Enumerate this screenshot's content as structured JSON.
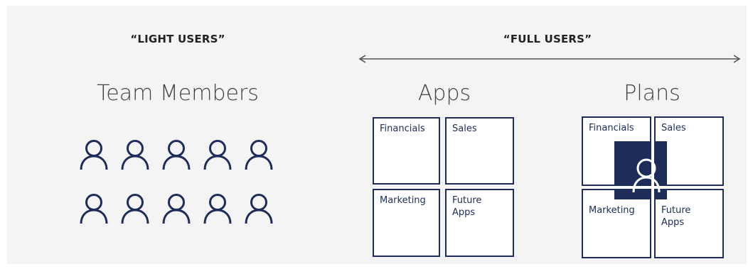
{
  "headings": {
    "light_users": "“LIGHT USERS”",
    "full_users": "“FULL USERS”"
  },
  "titles": {
    "team_members": "Team Members",
    "apps": "Apps",
    "plans": "Plans"
  },
  "apps_tiles": [
    {
      "label": "Financials",
      "highlighted": true
    },
    {
      "label": "Sales",
      "highlighted": false
    },
    {
      "label": "Marketing",
      "highlighted": false
    },
    {
      "label": "Future\nApps",
      "highlighted": false
    }
  ],
  "plans_tiles": [
    {
      "label": "Financials"
    },
    {
      "label": "Sales"
    },
    {
      "label": "Marketing"
    },
    {
      "label": "Future\nApps"
    }
  ],
  "icons": {
    "person": "person-outline-icon",
    "arrow": "double-headed-arrow"
  },
  "colors": {
    "navy": "#1e2c5a",
    "background": "#f4f4f4"
  },
  "team_member_count": 10
}
